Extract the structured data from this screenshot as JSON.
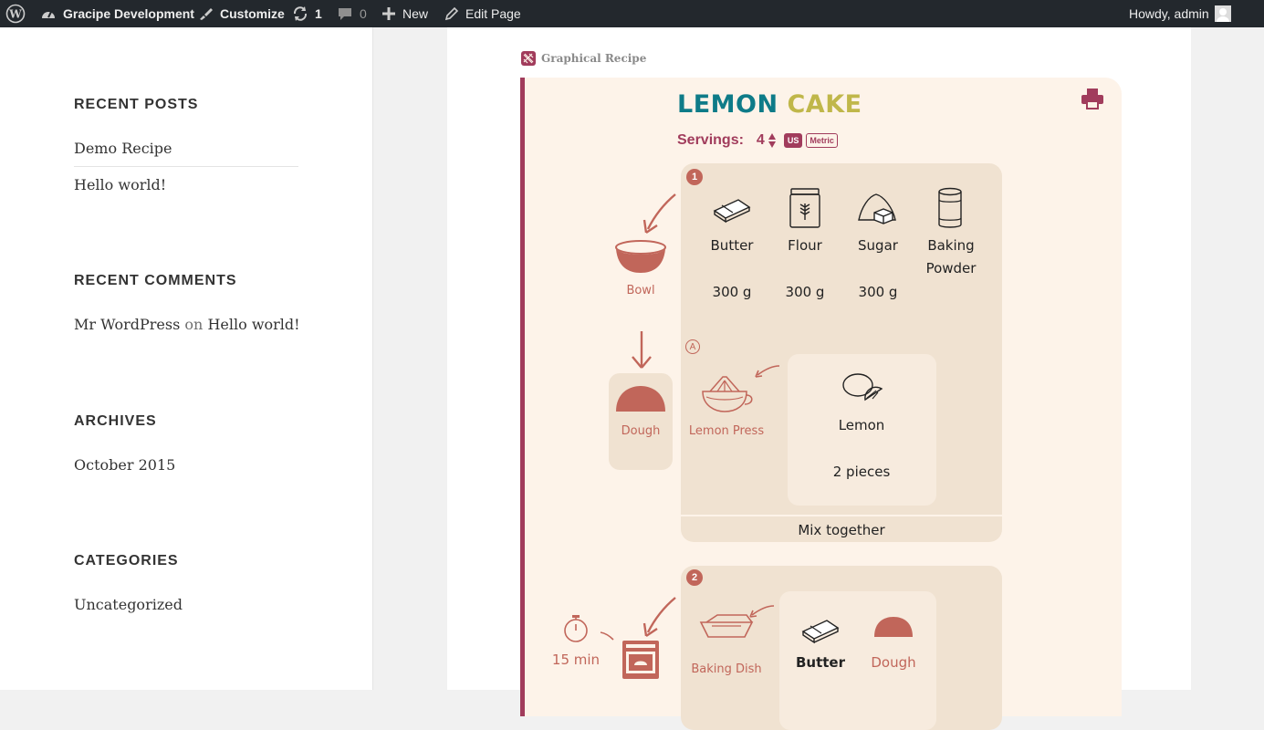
{
  "admin_bar": {
    "site_name": "Gracipe Development",
    "customize": "Customize",
    "updates_count": "1",
    "comments_count": "0",
    "new_label": "New",
    "edit_page": "Edit Page",
    "howdy": "Howdy, admin"
  },
  "sidebar": {
    "recent_posts": {
      "title": "RECENT POSTS",
      "items": [
        "Demo Recipe",
        "Hello world!"
      ]
    },
    "recent_comments": {
      "title": "RECENT COMMENTS",
      "author": "Mr WordPress",
      "on": "on",
      "post": "Hello world!"
    },
    "archives": {
      "title": "ARCHIVES",
      "items": [
        "October 2015"
      ]
    },
    "categories": {
      "title": "CATEGORIES",
      "items": [
        "Uncategorized"
      ]
    }
  },
  "recipe": {
    "plugin_label": "Graphical Recipe",
    "title_word1": "LEMON",
    "title_word2": "CAKE",
    "servings_label": "Servings:",
    "servings_value": "4",
    "unit_us": "US",
    "unit_metric": "Metric",
    "step1": {
      "number": "1",
      "tool": "Bowl",
      "ingredients": [
        {
          "name": "Butter",
          "qty": "300 g"
        },
        {
          "name": "Flour",
          "qty": "300 g"
        },
        {
          "name": "Sugar",
          "qty": "300 g"
        },
        {
          "name": "Baking Powder",
          "qty": ""
        }
      ],
      "substep_label": "A",
      "substep_tool": "Lemon Press",
      "substep_ingredient": {
        "name": "Lemon",
        "qty": "2 pieces"
      },
      "action": "Mix together",
      "result": "Dough"
    },
    "step2": {
      "number": "2",
      "timer": "15 min",
      "tool": "Baking Dish",
      "ingredients": [
        {
          "name": "Butter"
        },
        {
          "name": "Dough"
        }
      ]
    }
  },
  "colors": {
    "accent": "#a13c5c",
    "terracotta": "#c1665a",
    "teal": "#0e7b88",
    "olive": "#c0b74a",
    "card_bg": "#fdf3e9",
    "step_bg": "#f0e2d1"
  }
}
